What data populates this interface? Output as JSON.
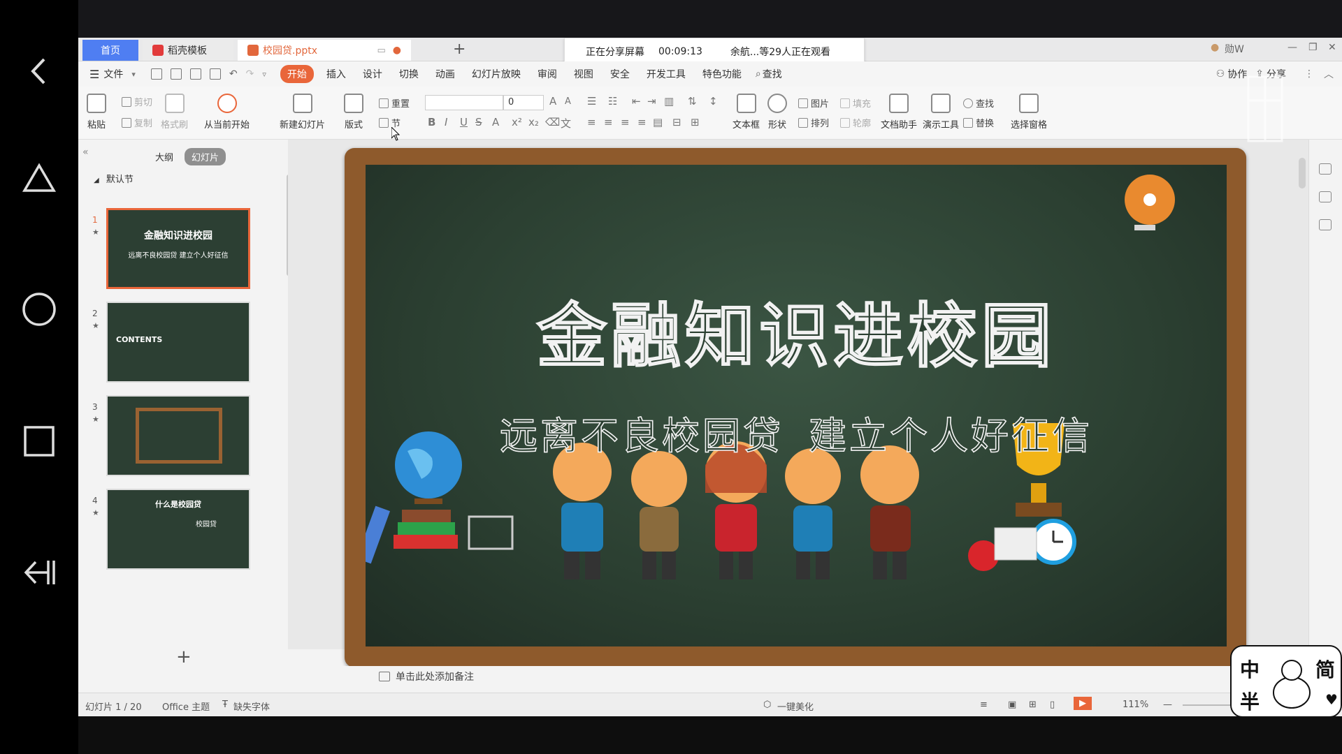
{
  "tabs": {
    "home": "首页",
    "docer": "稻壳模板",
    "file": "校园贷.pptx"
  },
  "share": {
    "status": "正在分享屏幕",
    "timer": "00:09:13",
    "viewers": "余航...等29人正在观看"
  },
  "window": {
    "user": "勋W"
  },
  "menu": {
    "file": "文件",
    "items": [
      "开始",
      "插入",
      "设计",
      "切换",
      "动画",
      "幻灯片放映",
      "审阅",
      "视图",
      "安全",
      "开发工具",
      "特色功能"
    ],
    "search": "查找",
    "collab": "协作",
    "share": "分享"
  },
  "ribbon": {
    "paste": "粘贴",
    "cut": "剪切",
    "copy": "复制",
    "format_painter": "格式刷",
    "play_from_current": "从当前开始",
    "new_slide": "新建幻灯片",
    "layout": "版式",
    "reset": "重置",
    "section": "节",
    "font_size": "0",
    "textbox": "文本框",
    "shape": "形状",
    "picture": "图片",
    "fill": "填充",
    "arrange": "排列",
    "outline": "轮廓",
    "doc_assistant": "文档助手",
    "present_tool": "演示工具",
    "find": "查找",
    "replace": "替换",
    "select_pane": "选择窗格"
  },
  "leftpanel": {
    "outline_tab": "大纲",
    "slides_tab": "幻灯片",
    "section": "默认节",
    "thumbs": [
      {
        "num": "1",
        "title": "金融知识进校园",
        "sub": "远离不良校园贷  建立个人好征信"
      },
      {
        "num": "2",
        "title": "CONTENTS",
        "sub": ""
      },
      {
        "num": "3",
        "title": "",
        "sub": ""
      },
      {
        "num": "4",
        "title": "什么是校园贷",
        "sub": "校园贷"
      }
    ],
    "add": "+"
  },
  "slide": {
    "title": "金融知识进校园",
    "subtitle_left": "远离不良校园贷",
    "subtitle_right": "建立个人好征信"
  },
  "notes": {
    "placeholder": "单击此处添加备注"
  },
  "status": {
    "slide_count": "幻灯片 1 / 20",
    "theme": "Office 主题",
    "missing_font": "缺失字体",
    "beautify": "一键美化",
    "zoom": "111%"
  },
  "sticker": {
    "tl": "中",
    "tr": "简",
    "bl": "半"
  },
  "colors": {
    "accent": "#e9663a",
    "home_tab": "#4f7ef2",
    "board": "#2b3f31",
    "frame": "#8e5a2c"
  }
}
